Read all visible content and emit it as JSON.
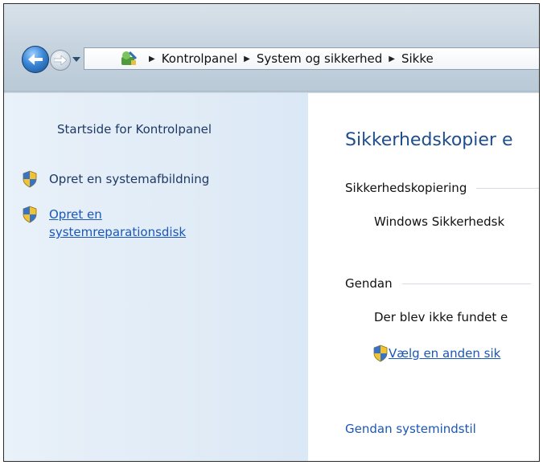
{
  "address_bar": {
    "crumbs": [
      "Kontrolpanel",
      "System og sikkerhed",
      "Sikke"
    ]
  },
  "left_pane": {
    "home_link": "Startside for Kontrolpanel",
    "tasks": [
      {
        "label": "Opret en systemafbildning"
      },
      {
        "label_line1": "Opret en",
        "label_line2": "systemreparationsdisk"
      }
    ]
  },
  "content": {
    "title": "Sikkerhedskopier e",
    "backup_section": "Sikkerhedskopiering",
    "backup_status": "Windows Sikkerhedsk",
    "restore_section": "Gendan",
    "restore_status": "Der blev ikke fundet e",
    "choose_other_link": "Vælg en anden sik",
    "restore_system_link": "Gendan systemindstil"
  },
  "colors": {
    "link": "#1a57b8",
    "title": "#1e4e8c",
    "left_pane": "#dbe8f5"
  },
  "icons": [
    "back-arrow-icon",
    "forward-arrow-icon",
    "dropdown-icon",
    "control-panel-icon",
    "uac-shield-icon"
  ]
}
